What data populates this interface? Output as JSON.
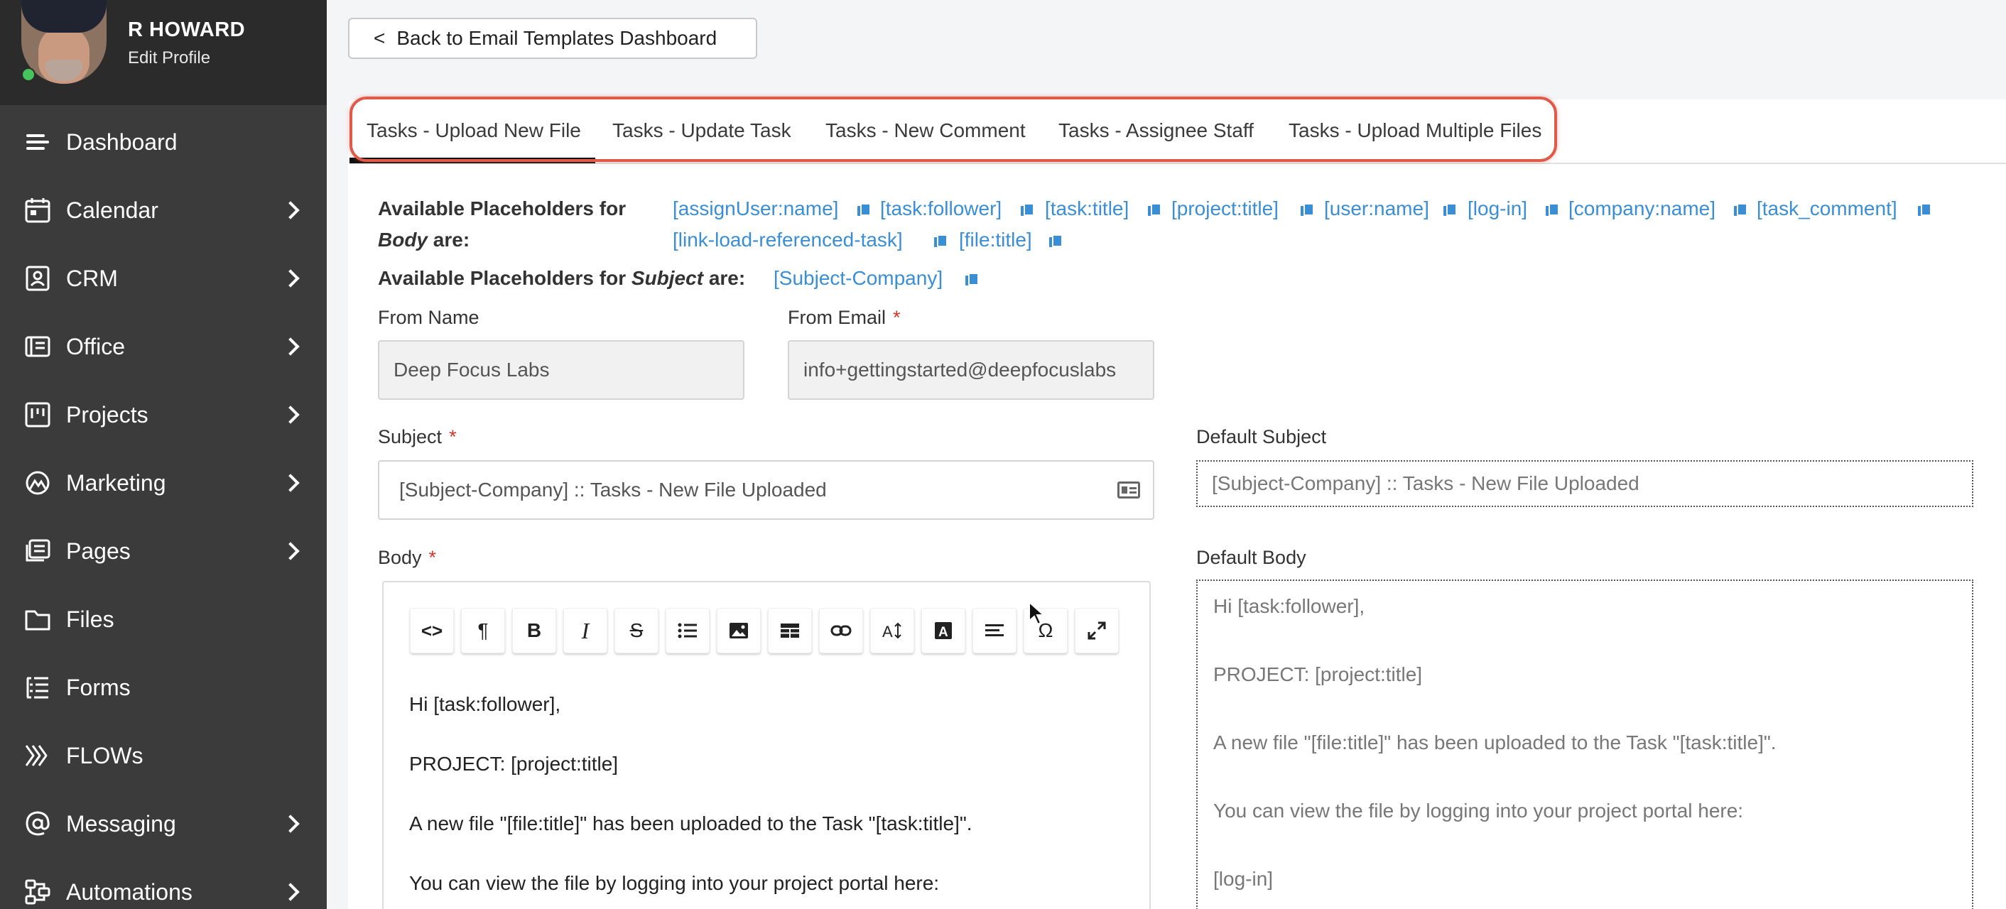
{
  "profile": {
    "name": "R HOWARD",
    "edit_label": "Edit Profile"
  },
  "nav": [
    {
      "label": "Dashboard",
      "icon": "menu-lines-icon",
      "has_submenu": false
    },
    {
      "label": "Calendar",
      "icon": "calendar-icon",
      "has_submenu": true
    },
    {
      "label": "CRM",
      "icon": "contact-card-icon",
      "has_submenu": true
    },
    {
      "label": "Office",
      "icon": "office-icon",
      "has_submenu": true
    },
    {
      "label": "Projects",
      "icon": "kanban-icon",
      "has_submenu": true
    },
    {
      "label": "Marketing",
      "icon": "marketing-icon",
      "has_submenu": true
    },
    {
      "label": "Pages",
      "icon": "pages-icon",
      "has_submenu": true
    },
    {
      "label": "Files",
      "icon": "folder-icon",
      "has_submenu": false
    },
    {
      "label": "Forms",
      "icon": "form-list-icon",
      "has_submenu": false
    },
    {
      "label": "FLOWs",
      "icon": "flows-icon",
      "has_submenu": false
    },
    {
      "label": "Messaging",
      "icon": "at-sign-icon",
      "has_submenu": true
    },
    {
      "label": "Automations",
      "icon": "automations-icon",
      "has_submenu": true
    }
  ],
  "back_button": {
    "arrow": "<",
    "label": "Back to Email Templates Dashboard"
  },
  "tabs": [
    {
      "label": "Tasks - Upload New File",
      "active": true
    },
    {
      "label": "Tasks - Update Task",
      "active": false
    },
    {
      "label": "Tasks - New Comment",
      "active": false
    },
    {
      "label": "Tasks - Assignee Staff",
      "active": false
    },
    {
      "label": "Tasks - Upload Multiple Files",
      "active": false
    }
  ],
  "placeholders": {
    "body_label_prefix": "Available Placeholders for",
    "body_label_em": "Body",
    "body_label_suffix": "are:",
    "body_items": [
      "[assignUser:name]",
      "[task:follower]",
      "[task:title]",
      "[project:title]",
      "[user:name]",
      "[log-in]",
      "[company:name]",
      "[task_comment]",
      "[link-load-referenced-task]",
      "[file:title]"
    ],
    "subject_label_prefix": "Available Placeholders for",
    "subject_label_em": "Subject",
    "subject_label_suffix": "are:",
    "subject_items": [
      "[Subject-Company]"
    ]
  },
  "form": {
    "from_name_label": "From Name",
    "from_name_value": "Deep Focus Labs",
    "from_email_label": "From Email",
    "from_email_value": "info+gettingstarted@deepfocuslabs",
    "required_mark": "*",
    "subject_label": "Subject",
    "subject_value": "[Subject-Company] :: Tasks - New File Uploaded",
    "default_subject_label": "Default Subject",
    "default_subject_value": "[Subject-Company] :: Tasks - New File Uploaded",
    "body_label": "Body",
    "default_body_label": "Default Body"
  },
  "toolbar": {
    "code": "<>",
    "paragraph": "¶",
    "bold": "B",
    "italic": "I",
    "strike": "S",
    "omega": "Ω",
    "fontcolor": "A"
  },
  "body_lines": [
    "Hi [task:follower],",
    "PROJECT: [project:title]",
    "A new file \"[file:title]\" has been uploaded to the Task \"[task:title]\".",
    "You can view the file by logging into your project portal here:"
  ],
  "default_body_lines": [
    "Hi [task:follower],",
    "PROJECT: [project:title]",
    "A new file \"[file:title]\" has been uploaded to the Task \"[task:title]\".",
    "You can view the file by logging into your project portal here:",
    "[log-in]"
  ]
}
